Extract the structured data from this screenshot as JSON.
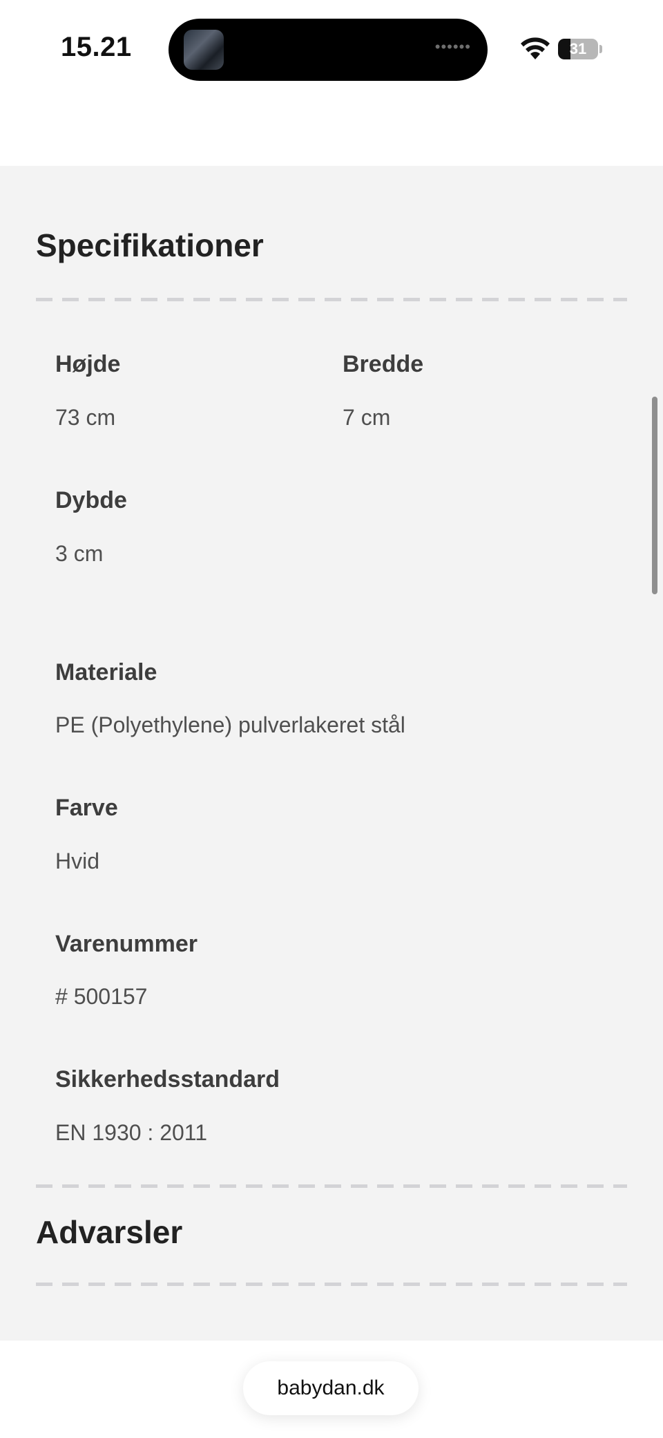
{
  "status_bar": {
    "time": "15.21",
    "battery": "31",
    "battery_level_percent": 31,
    "island_dots": "••••••"
  },
  "specs": {
    "title": "Specifikationer",
    "hojde": {
      "label": "Højde",
      "value": "73 cm"
    },
    "bredde": {
      "label": "Bredde",
      "value": "7 cm"
    },
    "dybde": {
      "label": "Dybde",
      "value": "3 cm"
    },
    "materiale": {
      "label": "Materiale",
      "value": "PE (Polyethylene) pulverlakeret stål"
    },
    "farve": {
      "label": "Farve",
      "value": "Hvid"
    },
    "varenummer": {
      "label": "Varenummer",
      "value": "# 500157"
    },
    "sikkerhed": {
      "label": "Sikkerhedsstandard",
      "value": "EN 1930 : 2011"
    }
  },
  "warnings": {
    "title": "Advarsler"
  },
  "browser": {
    "url": "babydan.dk"
  },
  "colors": {
    "background": "#f3f3f3",
    "heading": "#222222",
    "divider": "#d3d3d6"
  }
}
